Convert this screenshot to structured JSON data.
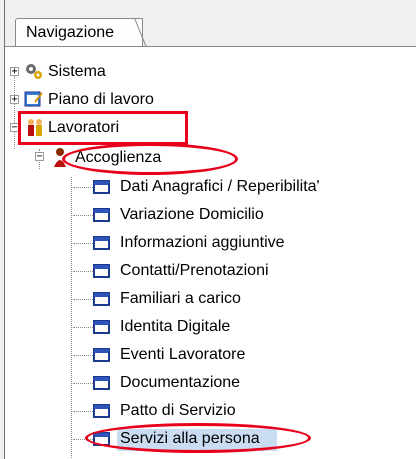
{
  "panel": {
    "tab_label": "Navigazione"
  },
  "tree": {
    "nodes": [
      {
        "label": "Sistema",
        "icon": "gears-icon"
      },
      {
        "label": "Piano di lavoro",
        "icon": "notepad-icon"
      },
      {
        "label": "Lavoratori",
        "icon": "workers-icon"
      },
      {
        "label": "Accoglienza",
        "icon": "reception-icon"
      }
    ],
    "children": [
      "Dati Anagrafici / Reperibilita'",
      "Variazione Domicilio",
      "Informazioni aggiuntive",
      "Contatti/Prenotazioni",
      "Familiari a carico",
      "Identita Digitale",
      "Eventi Lavoratore",
      "Documentazione",
      "Patto di Servizio",
      "Servizi alla persona"
    ]
  },
  "expander_symbols": {
    "plus": "+",
    "minus": "−"
  },
  "annotation_color": "#e8001a",
  "selection_color": "#c9dcf2"
}
